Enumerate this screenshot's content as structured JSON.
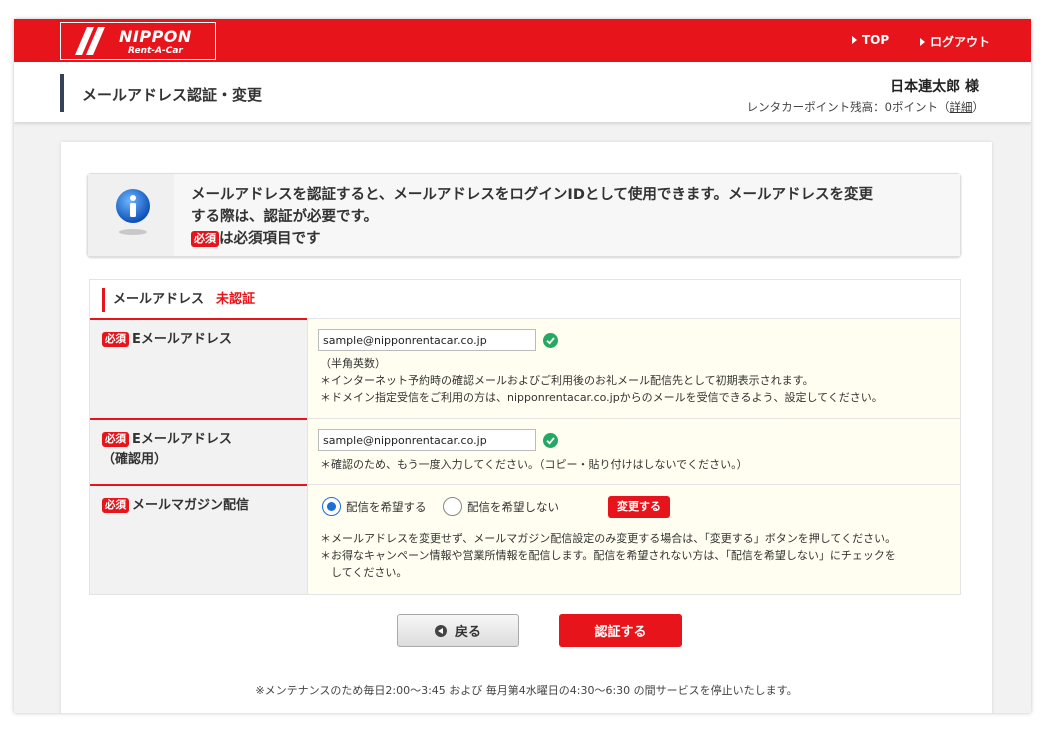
{
  "header": {
    "logo_main": "NIPPON",
    "logo_sub": "Rent-A-Car",
    "nav": [
      {
        "label": "TOP"
      },
      {
        "label": "ログアウト"
      }
    ],
    "brand_color": "#e8141b"
  },
  "subheader": {
    "page_title": "メールアドレス認証・変更",
    "user_name": "日本連太郎 様",
    "points_text": "レンタカーポイント残高：0ポイント（",
    "points_link": "詳細",
    "points_close": "）"
  },
  "info": {
    "icon": "info-icon",
    "line1": "メールアドレスを認証すると、メールアドレスをログインIDとして使用できます。メールアドレスを変更",
    "line2": "する際は、認証が必要です。",
    "required_badge": "必須",
    "required_text": "は必須項目です"
  },
  "section": {
    "title": "メールアドレス",
    "status": "未認証"
  },
  "rows": {
    "email": {
      "badge": "必須",
      "label": "Eメールアドレス",
      "value": "sample@nipponrentacar.co.jp",
      "notes": [
        "（半角英数）",
        "＊インターネット予約時の確認メールおよびご利用後のお礼メール配信先として初期表示されます。",
        "＊ドメイン指定受信をご利用の方は、nipponrentacar.co.jpからのメールを受信できるよう、設定してください。"
      ]
    },
    "email_confirm": {
      "badge": "必須",
      "label": "Eメールアドレス",
      "label_sub": "（確認用）",
      "value": "sample@nipponrentacar.co.jp",
      "notes": [
        "＊確認のため、もう一度入力してください。（コピー・貼り付けはしないでください。）"
      ]
    },
    "newsletter": {
      "badge": "必須",
      "label": "メールマガジン配信",
      "options": [
        "配信を希望する",
        "配信を希望しない"
      ],
      "selected": "配信を希望する",
      "change_button": "変更する",
      "notes": [
        "＊メールアドレスを変更せず、メールマガジン配信設定のみ変更する場合は、「変更する」ボタンを押してください。",
        "＊お得なキャンペーン情報や営業所情報を配信します。配信を希望されない方は、「配信を希望しない」にチェックを",
        "　してください。"
      ]
    }
  },
  "buttons": {
    "back": "戻る",
    "submit": "認証する"
  },
  "maintenance": "※メンテナンスのため毎日2:00～3:45 および 毎月第4水曜日の4:30～6:30 の間サービスを停止いたします。"
}
